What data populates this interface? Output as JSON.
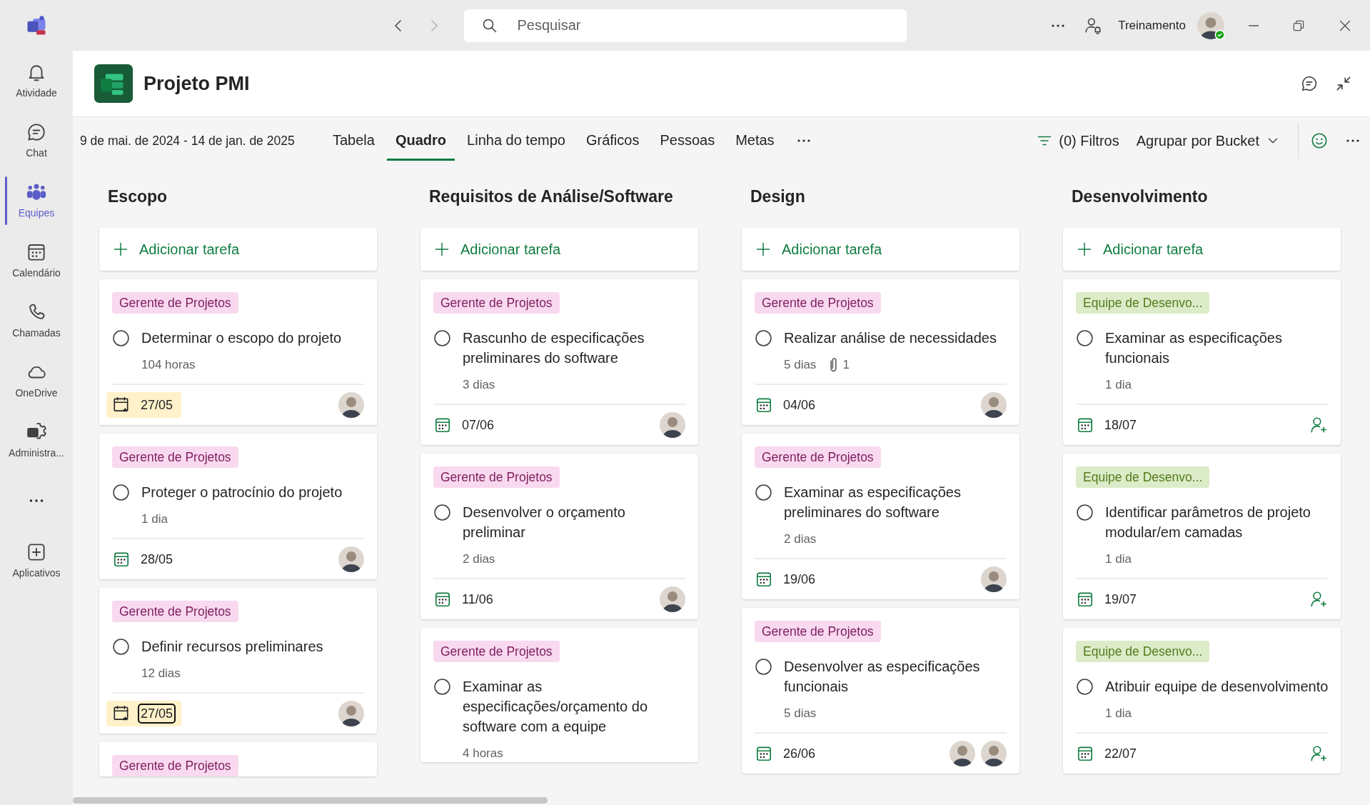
{
  "title_bar": {
    "search": {
      "placeholder": "Pesquisar"
    },
    "user_name": "Treinamento"
  },
  "rail": [
    {
      "label": "Atividade",
      "selected": false
    },
    {
      "label": "Chat",
      "selected": false
    },
    {
      "label": "Equipes",
      "selected": true
    },
    {
      "label": "Calendário",
      "selected": false
    },
    {
      "label": "Chamadas",
      "selected": false
    },
    {
      "label": "OneDrive",
      "selected": false
    },
    {
      "label": "Administra...",
      "selected": false
    },
    {
      "label": "Aplicativos",
      "selected": false
    }
  ],
  "plan": {
    "title": "Projeto PMI",
    "date_range": "9 de mai. de 2024 - 14 de jan. de 2025",
    "tabs": [
      {
        "label": "Tabela",
        "selected": false
      },
      {
        "label": "Quadro",
        "selected": true
      },
      {
        "label": "Linha do tempo",
        "selected": false
      },
      {
        "label": "Gráficos",
        "selected": false
      },
      {
        "label": "Pessoas",
        "selected": false
      },
      {
        "label": "Metas",
        "selected": false
      }
    ],
    "filters": "(0) Filtros",
    "group_by": "Agrupar por Bucket"
  },
  "buckets": [
    {
      "name": "Escopo",
      "add_task": "Adicionar tarefa",
      "tasks": [
        {
          "label": {
            "text": "Gerente de Projetos",
            "color": "#f9d9ef"
          },
          "completed": false,
          "title": "Determinar o escopo do projeto",
          "duration": "104 horas",
          "due": {
            "date": "27/05",
            "soon": true,
            "focused": false
          }
        },
        {
          "label": {
            "text": "Gerente de Projetos",
            "color": "#f9d9ef"
          },
          "completed": false,
          "title": "Proteger o patrocínio do projeto",
          "duration": "1 dia",
          "due": {
            "date": "28/05",
            "soon": false,
            "focused": false
          }
        },
        {
          "label": {
            "text": "Gerente de Projetos",
            "color": "#f9d9ef"
          },
          "completed": false,
          "title": "Definir recursos preliminares",
          "duration": "12 dias",
          "due": {
            "date": "27/05",
            "soon": true,
            "focused": true
          }
        },
        {
          "label": {
            "text": "Gerente de Projetos",
            "color": "#f9d9ef"
          }
        }
      ]
    },
    {
      "name": "Requisitos de Análise/Software",
      "add_task": "Adicionar tarefa",
      "tasks": [
        {
          "label": {
            "text": "Gerente de Projetos",
            "color": "#f9d9ef"
          },
          "completed": false,
          "title": "Rascunho de especificações preliminares do software",
          "duration": "3 dias",
          "due": {
            "date": "07/06",
            "soon": false,
            "focused": false
          }
        },
        {
          "label": {
            "text": "Gerente de Projetos",
            "color": "#f9d9ef"
          },
          "completed": false,
          "title": "Desenvolver o orçamento preliminar",
          "duration": "2 dias",
          "due": {
            "date": "11/06",
            "soon": false,
            "focused": false
          }
        },
        {
          "label": {
            "text": "Gerente de Projetos",
            "color": "#f9d9ef"
          },
          "completed": false,
          "title": "Examinar as especificações/orçamento do software com a equipe",
          "duration": "4 horas"
        }
      ]
    },
    {
      "name": "Design",
      "add_task": "Adicionar tarefa",
      "tasks": [
        {
          "label": {
            "text": "Gerente de Projetos",
            "color": "#f9d9ef"
          },
          "completed": false,
          "title": "Realizar análise de necessidades",
          "duration": "5 dias",
          "attachments": "1",
          "due": {
            "date": "04/06",
            "soon": false,
            "focused": false
          }
        },
        {
          "label": {
            "text": "Gerente de Projetos",
            "color": "#f9d9ef"
          },
          "completed": false,
          "title": "Examinar as especificações preliminares do software",
          "duration": "2 dias",
          "due": {
            "date": "19/06",
            "soon": false,
            "focused": false
          }
        },
        {
          "label": {
            "text": "Gerente de Projetos",
            "color": "#f9d9ef"
          },
          "completed": false,
          "title": "Desenvolver as especificações funcionais",
          "duration": "5 dias",
          "due": {
            "date": "26/06",
            "soon": false,
            "focused": false
          }
        }
      ]
    },
    {
      "name": "Desenvolvimento",
      "add_task": "Adicionar tarefa",
      "tasks": [
        {
          "label": {
            "text": "Equipe de Desenvo...",
            "color": "#dcebc8"
          },
          "completed": false,
          "title": "Examinar as especificações funcionais",
          "duration": "1 dia",
          "due": {
            "date": "18/07",
            "soon": false,
            "focused": false
          }
        },
        {
          "label": {
            "text": "Equipe de Desenvo...",
            "color": "#dcebc8"
          },
          "completed": false,
          "title": "Identificar parâmetros de projeto modular/em camadas",
          "duration": "1 dia",
          "due": {
            "date": "19/07",
            "soon": false,
            "focused": false
          }
        },
        {
          "label": {
            "text": "Equipe de Desenvo...",
            "color": "#dcebc8"
          },
          "completed": false,
          "title": "Atribuir equipe de desenvolvimento",
          "duration": "1 dia",
          "due": {
            "date": "22/07",
            "soon": false,
            "focused": false
          }
        }
      ]
    }
  ]
}
